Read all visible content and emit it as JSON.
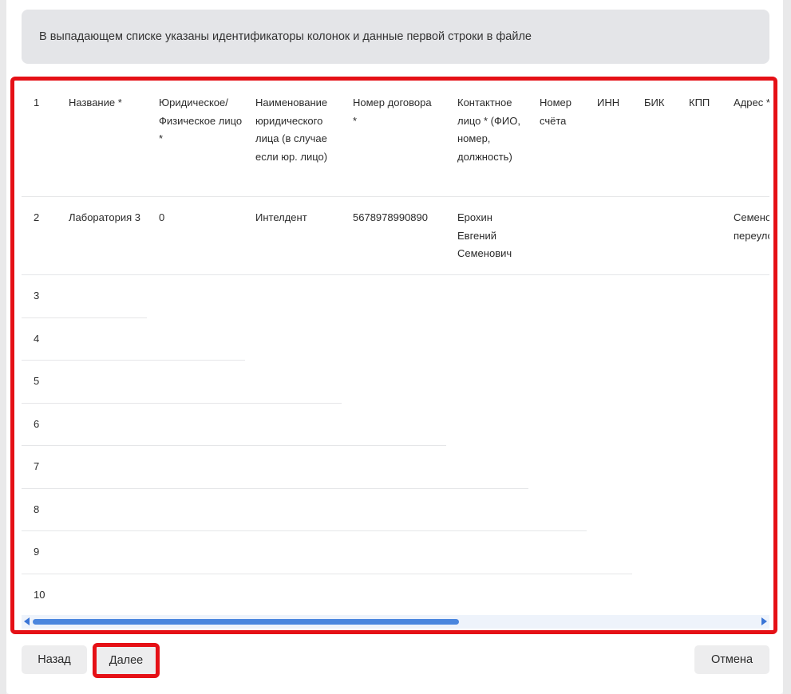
{
  "info_text": "В выпадающем списке указаны идентификаторы колонок и данные первой строки в файле",
  "columns": [
    "1",
    "Название *",
    "Юридическое/ Физическое лицо *",
    "Наименование юридического лица (в случае если юр. лицо)",
    "Номер договора *",
    "Контактное лицо * (ФИО, номер, должность)",
    "Номер счёта",
    "ИНН",
    "БИК",
    "КПП",
    "Адрес *"
  ],
  "data_row": {
    "num": "2",
    "name": "Лаборатория 3",
    "entity_type": "0",
    "legal_name": "Интелдент",
    "contract_number": "5678978990890",
    "contact": "Ерохин Евгений Семенович",
    "account": "",
    "inn": "",
    "bik": "",
    "kpp": "",
    "address": "Семеновский переулок"
  },
  "select_rows": [
    "3",
    "4",
    "5",
    "6",
    "7",
    "8",
    "9",
    "10"
  ],
  "buttons": {
    "back": "Назад",
    "next": "Далее",
    "cancel": "Отмена"
  },
  "colors": {
    "highlight": "#e51016",
    "scroll_thumb": "#4a86de",
    "info_bg": "#e4e5e8"
  }
}
